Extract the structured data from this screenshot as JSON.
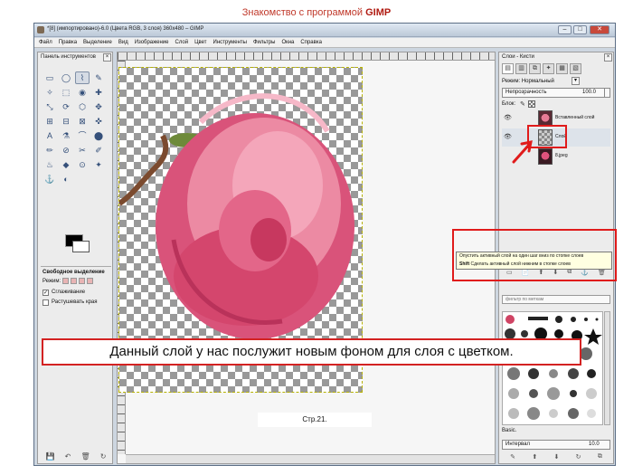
{
  "slide": {
    "title_prefix": "Знакомство с программой ",
    "title_app": "GIMP",
    "caption": "Данный слой у нас послужит новым фоном для слоя с цветком.",
    "page_number": "Стр.21."
  },
  "window": {
    "title": "*[8] (импортировано)-6.0 (Цвета RGB, 3 слоя) 360x480 – GIMP",
    "minimize": "–",
    "maximize": "□",
    "close": "✕"
  },
  "menubar": [
    "Файл",
    "Правка",
    "Выделение",
    "Вид",
    "Изображение",
    "Слой",
    "Цвет",
    "Инструменты",
    "Фильтры",
    "Окна",
    "Справка"
  ],
  "toolbox": {
    "title": "Панель инструментов",
    "close": "×",
    "tools": [
      "▭",
      "◯",
      "⌇",
      "✎",
      "✧",
      "⬚",
      "◉",
      "✚",
      "⤡",
      "⟳",
      "⬡",
      "✥",
      "⊞",
      "⊟",
      "⊠",
      "✜",
      "A",
      "⚗",
      "⌒",
      "⬤",
      "✏",
      "⊘",
      "✂",
      "✐",
      "♨",
      "◆",
      "⊙",
      "✦",
      "⚓",
      "◐"
    ],
    "options": {
      "title": "Свободное выделение",
      "mode_label": "Режим:",
      "antialias_label": "Сглаживание",
      "antialias_checked": true,
      "feather_label": "Растушевать края",
      "feather_checked": false,
      "check_mark": "✓"
    },
    "bottom_icons": [
      "💾",
      "↶",
      "🗑",
      "↻"
    ]
  },
  "layers": {
    "title": "Слои - Кисти",
    "close": "×",
    "tabs": [
      "▤",
      "▥",
      "⧉",
      "✦",
      "▦",
      "▧"
    ],
    "mode_label": "Режим: Нормальный",
    "mode_dropdown": "▾",
    "opacity_label": "Непрозрачность",
    "opacity_value": "100.0",
    "lock_label": "Блок:",
    "lock_brush_icon": "✎",
    "rows": [
      {
        "eye": "👁",
        "name": "Вставленный слой"
      },
      {
        "eye": "👁",
        "name": "Слой"
      },
      {
        "eye": "",
        "name": "8.jpeg"
      }
    ],
    "buttons": [
      "▭",
      "📄",
      "⬆",
      "⬇",
      "⧉",
      "⚓",
      "🗑"
    ],
    "filter_placeholder": "фильтр по меткам",
    "brush_name": "Basic.",
    "interval_label": "Интервал",
    "interval_value": "10.0",
    "bottom_icons": [
      "✎",
      "⬆",
      "⬇",
      "↻",
      "⧉"
    ]
  },
  "tooltip": {
    "line1": "Опустить активный слой на один шаг вниз по стопке слоев",
    "line2_key": "Shift",
    "line2": "Сделать активный слой нижним в стопке слоев"
  }
}
